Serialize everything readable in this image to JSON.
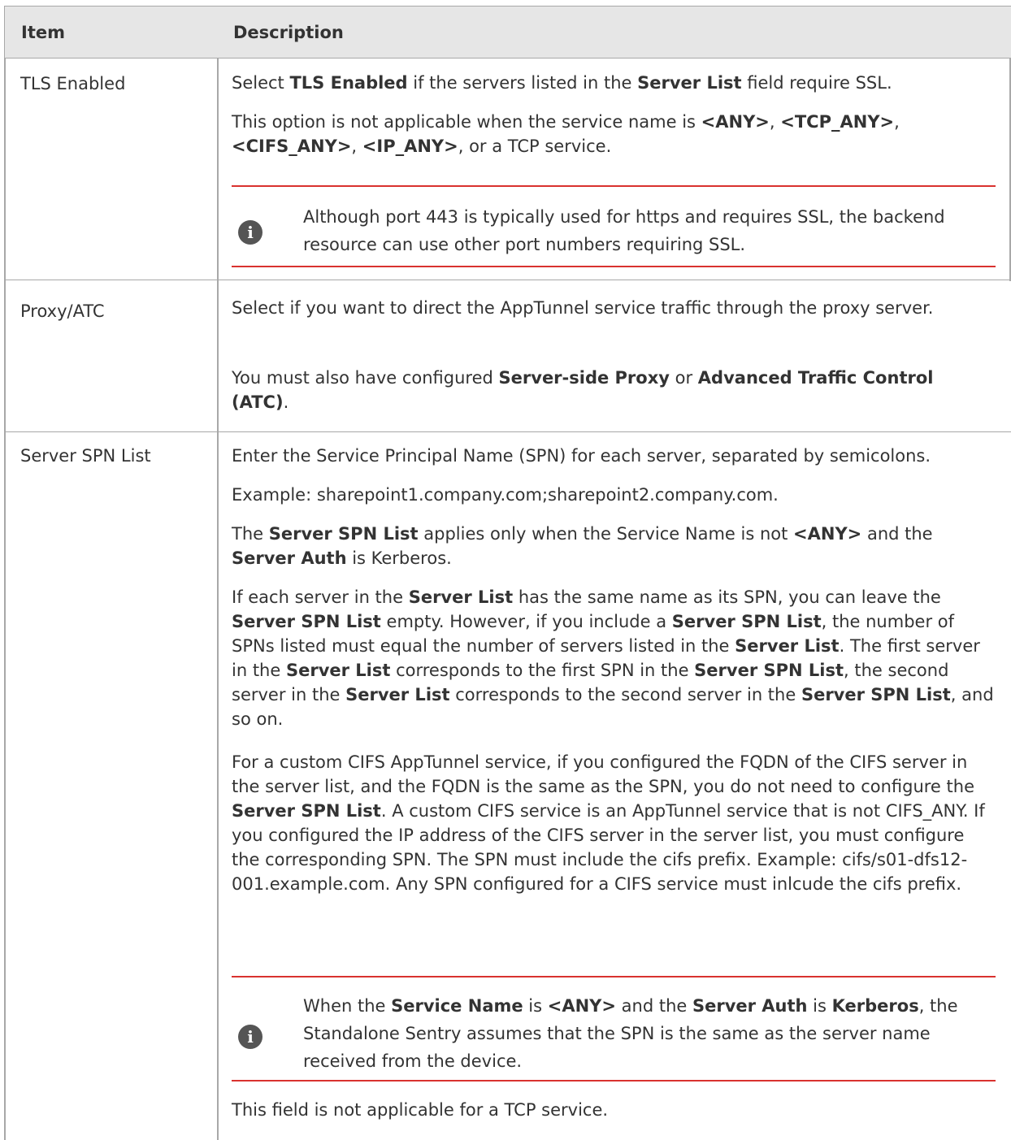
{
  "header": {
    "item": "Item",
    "description": "Description"
  },
  "rows": {
    "tls": {
      "item": "TLS Enabled",
      "p1": [
        "Select ",
        "TLS Enabled",
        " if the servers listed in the ",
        "Server List",
        " field require SSL."
      ],
      "p2": [
        "This option is not applicable when the service name is ",
        "<ANY>",
        ", ",
        "<TCP_ANY>",
        ",",
        "<CIFS_ANY>",
        ", ",
        "<IP_ANY>",
        ", or a TCP service."
      ],
      "note": [
        "Although port 443 is typically used for https and requires SSL, the backend resource can use other port numbers requiring SSL."
      ]
    },
    "proxy": {
      "item": "Proxy/ATC",
      "p1": [
        "Select if you want to direct the AppTunnel service traffic through the proxy server."
      ],
      "p2": [
        "You must also have configured ",
        "Server-side Proxy",
        " or ",
        "Advanced Traffic Control (ATC)",
        "."
      ]
    },
    "spn": {
      "item": "Server SPN List",
      "p1": [
        "Enter the Service Principal Name (SPN) for each server, separated by semicolons."
      ],
      "p2": [
        "Example: sharepoint1.company.com;sharepoint2.company.com."
      ],
      "p3": [
        "The ",
        "Server SPN List",
        " applies only when the Service Name is not ",
        "<ANY>",
        " and the ",
        "Server Auth",
        " is Kerberos."
      ],
      "p4": [
        "If each server in the ",
        "Server List",
        " has the same name as its SPN, you can leave the ",
        "Server SPN List",
        " empty. However, if you include a ",
        "Server SPN List",
        ", the number of SPNs listed must equal the number of servers listed in the ",
        "Server List",
        ". The first server in the ",
        "Server List",
        " corresponds to the first SPN in the ",
        "Server SPN List",
        ", the second server in the ",
        "Server List",
        " corresponds to the second server in the ",
        "Server SPN List",
        ", and so on."
      ],
      "p5": [
        "For a custom CIFS AppTunnel service, if you configured the FQDN of the CIFS server in the server list, and the FQDN is the same as the SPN, you do not need to configure the ",
        "Server SPN List",
        ". A custom CIFS service is an AppTunnel service that is not CIFS_ANY. If you configured the IP address of the CIFS server in the server list, you must configure the corresponding SPN. The SPN must include the cifs prefix. Example: cifs/s01-dfs12-001.example.com. Any SPN configured for a CIFS service must inlcude the cifs prefix."
      ],
      "note": [
        "When the ",
        "Service Name",
        " is ",
        "<ANY>",
        " and the ",
        "Server Auth",
        " is ",
        "Kerberos",
        ", the Standalone Sentry assumes that the SPN is the same as the server name received from the device."
      ],
      "p6": [
        "This field is not applicable for a TCP service."
      ]
    }
  },
  "icons": {
    "note": "info-icon"
  },
  "note_icon_glyph": "i",
  "colors": {
    "header_bg": "#e6e6e6",
    "border": "#a8a8a8",
    "note_rule": "#d9322f",
    "icon_bg": "#555555"
  }
}
